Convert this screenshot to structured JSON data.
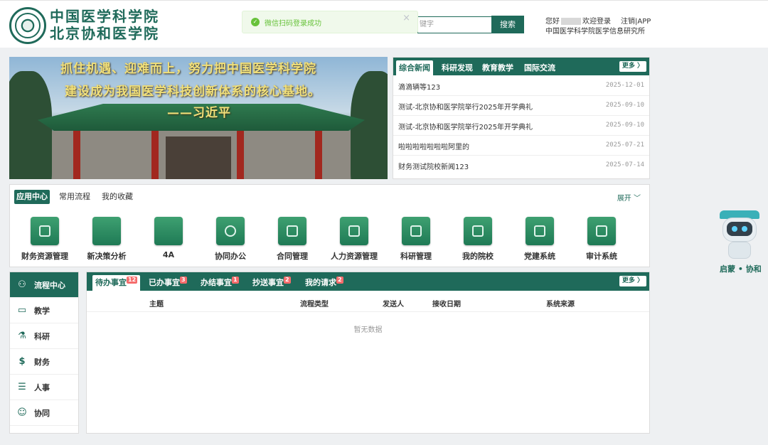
{
  "header": {
    "logo_line1": "中国医学科学院",
    "logo_line2": "北京协和医学院",
    "toast_message": "微信扫码登录成功",
    "toast_close": "×",
    "search_placeholder": "键字",
    "search_button": "搜索",
    "greeting_prefix": "您好",
    "greeting_suffix": "欢迎登录",
    "logout": "注销",
    "separator": "|",
    "app_link": "APP",
    "org": "中国医学科学院医学信息研究所"
  },
  "banner": {
    "line1": "抓住机遇、迎难而上，努力把中国医学科学院",
    "line2": "建设成为我国医学科技创新体系的核心基地。",
    "line3": "——习近平"
  },
  "news": {
    "tabs": [
      "综合新闻",
      "科研发现",
      "教育教学",
      "国际交流"
    ],
    "more": "更多 〉",
    "items": [
      {
        "title": "滴滴辆等123",
        "date": "2025-12-01"
      },
      {
        "title": "测试-北京协和医学院举行2025年开学典礼",
        "date": "2025-09-10"
      },
      {
        "title": "测试-北京协和医学院举行2025年开学典礼",
        "date": "2025-09-10"
      },
      {
        "title": "啦啦啦啦啦啦啦阿里的",
        "date": "2025-07-21"
      },
      {
        "title": "财务测试院校新闻123",
        "date": "2025-07-14"
      }
    ]
  },
  "apps": {
    "tabs": [
      "应用中心",
      "常用流程",
      "我的收藏"
    ],
    "expand": "展开 ﹀",
    "items": [
      {
        "label": "财务资源管理",
        "icon": "finance-icon"
      },
      {
        "label": "新决策分析",
        "icon": "analysis-icon"
      },
      {
        "label": "4A",
        "icon": "auth-icon"
      },
      {
        "label": "协同办公",
        "icon": "collab-icon"
      },
      {
        "label": "合同管理",
        "icon": "contract-icon"
      },
      {
        "label": "人力资源管理",
        "icon": "hr-icon"
      },
      {
        "label": "科研管理",
        "icon": "research-icon"
      },
      {
        "label": "我的院校",
        "icon": "school-icon"
      },
      {
        "label": "党建系统",
        "icon": "party-icon"
      },
      {
        "label": "审计系统",
        "icon": "audit-icon"
      }
    ]
  },
  "sidebar": {
    "items": [
      {
        "label": "流程中心",
        "icon": "flow-icon"
      },
      {
        "label": "教学",
        "icon": "teaching-icon"
      },
      {
        "label": "科研",
        "icon": "flask-icon"
      },
      {
        "label": "财务",
        "icon": "money-icon"
      },
      {
        "label": "人事",
        "icon": "personnel-icon"
      },
      {
        "label": "协同",
        "icon": "cooperation-icon"
      }
    ]
  },
  "workflow": {
    "tabs": [
      {
        "label": "待办事宜",
        "badge": "12"
      },
      {
        "label": "已办事宜",
        "badge": "3"
      },
      {
        "label": "办结事宜",
        "badge": "1"
      },
      {
        "label": "抄送事宜",
        "badge": "2"
      },
      {
        "label": "我的请求",
        "badge": "2"
      }
    ],
    "more": "更多 〉",
    "columns": [
      "主题",
      "流程类型",
      "发送人",
      "接收日期",
      "系统来源"
    ],
    "empty_text": "暂无数据"
  },
  "mascot": {
    "label": "启蒙 • 协和"
  }
}
